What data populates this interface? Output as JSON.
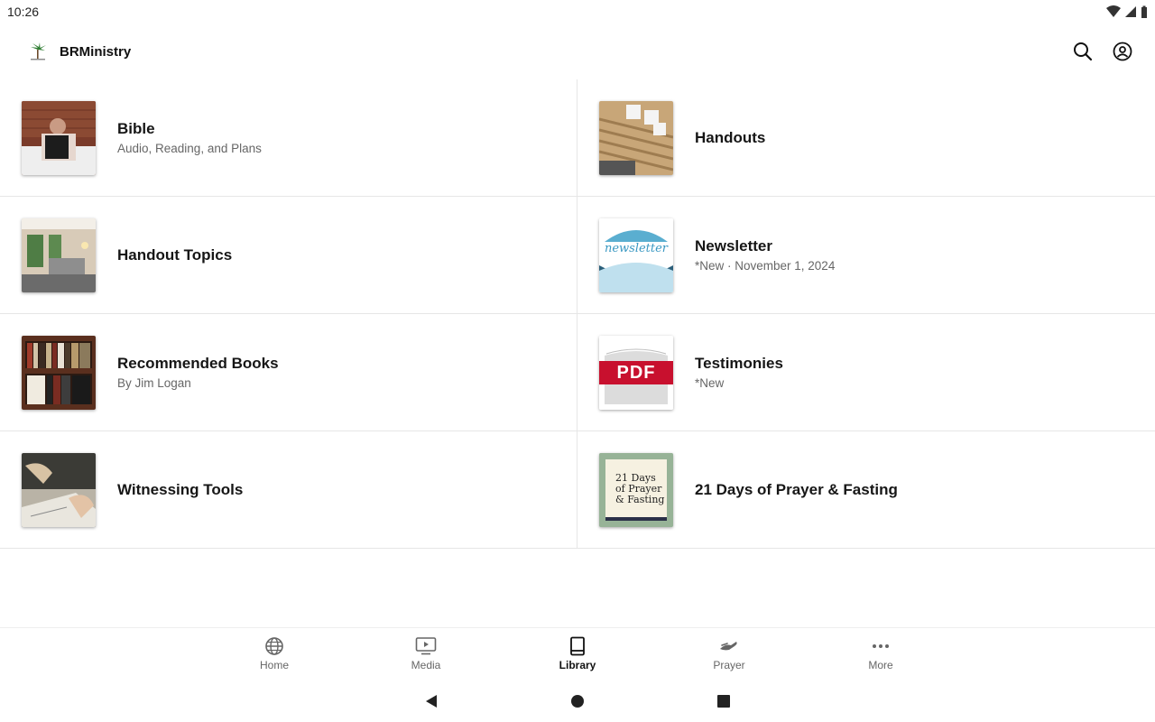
{
  "status_bar": {
    "time": "10:26",
    "icons": [
      "wifi-icon",
      "signal-icon",
      "battery-icon"
    ]
  },
  "app_bar": {
    "title": "BRMinistry",
    "logo": "palm-tree-logo",
    "actions": [
      "search-icon",
      "account-icon"
    ]
  },
  "library": {
    "items": [
      {
        "title": "Bible",
        "subtitle": "Audio, Reading, and Plans",
        "thumb": "bible-reading-photo"
      },
      {
        "title": "Handouts",
        "subtitle": "",
        "thumb": "file-folders-photo"
      },
      {
        "title": "Handout Topics",
        "subtitle": "",
        "thumb": "living-room-photo"
      },
      {
        "title": "Newsletter",
        "subtitle": "*New · November 1, 2024",
        "thumb": "newsletter-graphic"
      },
      {
        "title": "Recommended Books",
        "subtitle": "By Jim Logan",
        "thumb": "bookshelf-photo"
      },
      {
        "title": "Testimonies",
        "subtitle": "*New",
        "thumb": "pdf-graphic",
        "thumb_text": "PDF"
      },
      {
        "title": "Witnessing Tools",
        "subtitle": "",
        "thumb": "writing-hands-photo"
      },
      {
        "title": "21 Days of Prayer & Fasting",
        "subtitle": "",
        "thumb": "prayer-fasting-graphic",
        "thumb_text": [
          "21 Days",
          "of Prayer",
          "& Fasting"
        ]
      }
    ],
    "newsletter_thumb_text": "newsletter"
  },
  "bottom_nav": {
    "items": [
      {
        "label": "Home",
        "icon": "globe-icon",
        "active": false
      },
      {
        "label": "Media",
        "icon": "play-screen-icon",
        "active": false
      },
      {
        "label": "Library",
        "icon": "book-icon",
        "active": true
      },
      {
        "label": "Prayer",
        "icon": "praying-hands-icon",
        "active": false
      },
      {
        "label": "More",
        "icon": "more-dots-icon",
        "active": false
      }
    ]
  },
  "system_nav": [
    "back-icon",
    "home-circle-icon",
    "recents-square-icon"
  ],
  "colors": {
    "accent": "#111111",
    "inactive": "#666666",
    "divider": "#e6e6e6",
    "pdf_red": "#c8102e",
    "newsletter_blue": "#4fa3c7"
  }
}
